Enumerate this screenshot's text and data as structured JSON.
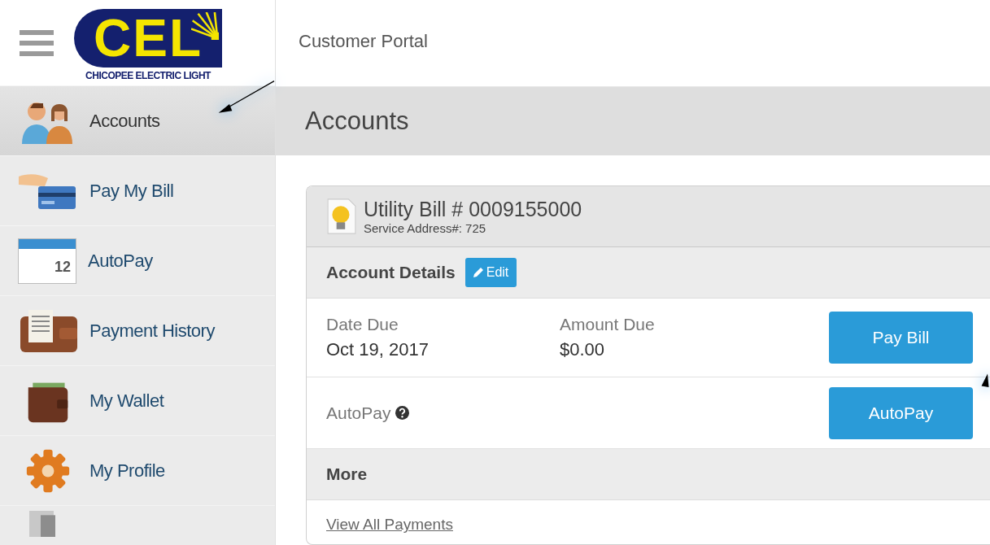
{
  "header": {
    "logo_mark": "CEL",
    "logo_caption": "CHICOPEE ELECTRIC LIGHT",
    "title": "Customer Portal"
  },
  "sidebar": {
    "items": [
      {
        "kind": "people",
        "label": "Accounts",
        "selected": true
      },
      {
        "kind": "card",
        "label": "Pay My Bill",
        "selected": false
      },
      {
        "kind": "calendar",
        "label": "AutoPay",
        "selected": false,
        "icon_text": "12"
      },
      {
        "kind": "ledger",
        "label": "Payment History",
        "selected": false
      },
      {
        "kind": "wallet",
        "label": "My Wallet",
        "selected": false
      },
      {
        "kind": "gear",
        "label": "My Profile",
        "selected": false
      },
      {
        "kind": "door",
        "selected": false
      }
    ]
  },
  "page_title": "Accounts",
  "account_card": {
    "title": "Utility Bill # 0009155000",
    "subtitle": "Service Address#: 725",
    "details_heading": "Account Details",
    "edit_button": "Edit",
    "fields": [
      {
        "label": "Date Due",
        "value": "Oct 19, 2017"
      },
      {
        "label": "Amount Due",
        "value": "$0.00"
      }
    ],
    "pay_button": "Pay Bill",
    "autopay_label": "AutoPay",
    "autopay_button": "AutoPay",
    "more_heading": "More",
    "more_link": "View All Payments"
  }
}
